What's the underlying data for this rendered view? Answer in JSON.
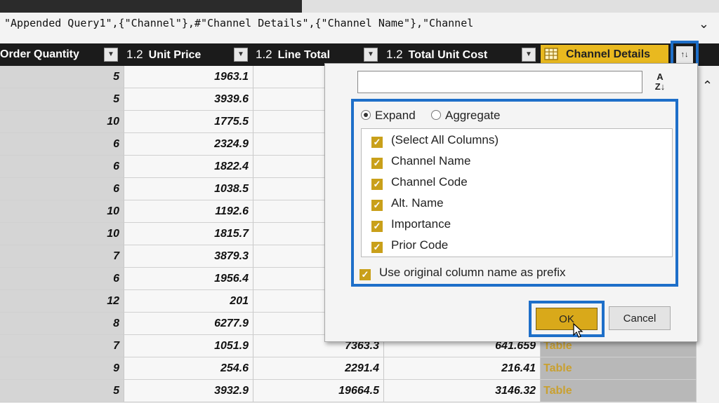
{
  "formula_bar": {
    "text": "\"Appended Query1\",{\"Channel\"},#\"Channel Details\",{\"Channel Name\"},\"Channel",
    "expand_icon": "chevron-down-icon"
  },
  "columns": {
    "order_quantity": {
      "label": "Order Quantity"
    },
    "unit_price": {
      "type": "1.2",
      "label": "Unit Price"
    },
    "line_total": {
      "type": "1.2",
      "label": "Line Total"
    },
    "total_unit_cost": {
      "type": "1.2",
      "label": "Total Unit Cost"
    },
    "channel_details": {
      "label": "Channel Details",
      "icon": "table-icon"
    }
  },
  "rows": [
    {
      "qty": "5",
      "price": "1963.1",
      "line": "",
      "cost": "",
      "table": ""
    },
    {
      "qty": "5",
      "price": "3939.6",
      "line": "",
      "cost": "",
      "table": ""
    },
    {
      "qty": "10",
      "price": "1775.5",
      "line": "",
      "cost": "",
      "table": ""
    },
    {
      "qty": "6",
      "price": "2324.9",
      "line": "",
      "cost": "",
      "table": ""
    },
    {
      "qty": "6",
      "price": "1822.4",
      "line": "",
      "cost": "",
      "table": ""
    },
    {
      "qty": "6",
      "price": "1038.5",
      "line": "",
      "cost": "",
      "table": ""
    },
    {
      "qty": "10",
      "price": "1192.6",
      "line": "",
      "cost": "",
      "table": ""
    },
    {
      "qty": "10",
      "price": "1815.7",
      "line": "",
      "cost": "",
      "table": ""
    },
    {
      "qty": "7",
      "price": "3879.3",
      "line": "",
      "cost": "",
      "table": ""
    },
    {
      "qty": "6",
      "price": "1956.4",
      "line": "",
      "cost": "",
      "table": ""
    },
    {
      "qty": "12",
      "price": "201",
      "line": "",
      "cost": "",
      "table": ""
    },
    {
      "qty": "8",
      "price": "6277.9",
      "line": "",
      "cost": "",
      "table": ""
    },
    {
      "qty": "7",
      "price": "1051.9",
      "line": "7363.3",
      "cost": "641.659",
      "table": "Table"
    },
    {
      "qty": "9",
      "price": "254.6",
      "line": "2291.4",
      "cost": "216.41",
      "table": "Table"
    },
    {
      "qty": "5",
      "price": "3932.9",
      "line": "19664.5",
      "cost": "3146.32",
      "table": "Table"
    }
  ],
  "popup": {
    "search_value": "",
    "sort_icon": "sort-az-icon",
    "modes": {
      "expand": "Expand",
      "aggregate": "Aggregate",
      "selected": "expand"
    },
    "column_items": [
      {
        "label": "(Select All Columns)",
        "checked": true
      },
      {
        "label": "Channel Name",
        "checked": true
      },
      {
        "label": "Channel Code",
        "checked": true
      },
      {
        "label": "Alt. Name",
        "checked": true
      },
      {
        "label": "Importance",
        "checked": true
      },
      {
        "label": "Prior Code",
        "checked": true
      }
    ],
    "prefix_label": "Use original column name as prefix",
    "prefix_checked": true,
    "ok_label": "OK",
    "cancel_label": "Cancel"
  },
  "colors": {
    "accent_gold": "#e9b91f",
    "highlight_blue": "#1e6fc9",
    "header_bg": "#1b1b1b"
  }
}
